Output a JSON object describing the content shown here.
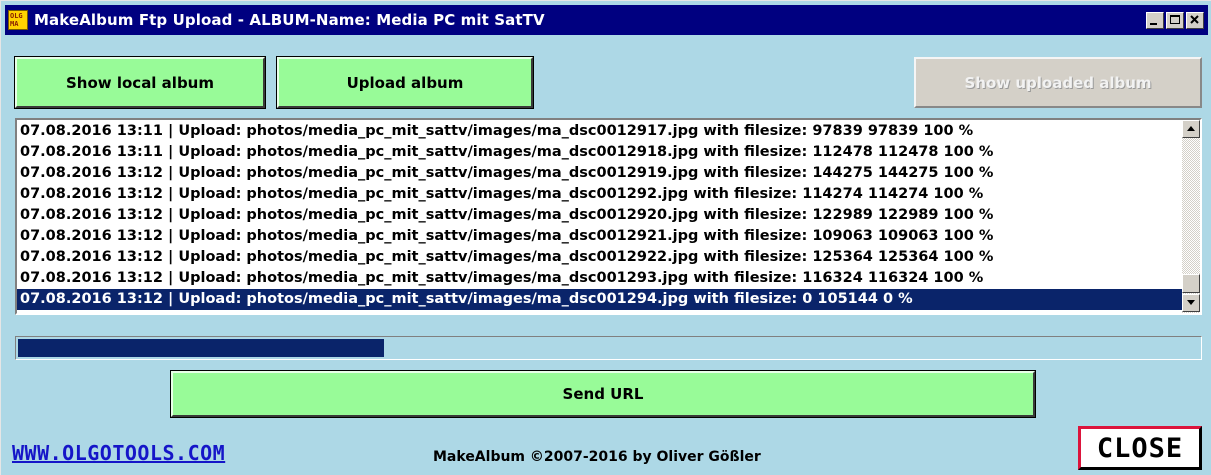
{
  "window": {
    "title": "MakeAlbum Ftp Upload - ALBUM-Name: Media PC mit SatTV",
    "icon": {
      "name": "olgo-app-icon",
      "line1": "OLG",
      "line2": "MA"
    },
    "controls": [
      "minimize-icon",
      "maximize-icon",
      "close-icon"
    ]
  },
  "toolbar": {
    "show_local": "Show local album",
    "upload": "Upload album",
    "show_uploaded": "Show uploaded album"
  },
  "log": {
    "rows": [
      "07.08.2016 13:11 | Upload: photos/media_pc_mit_sattv/images/ma_dsc0012917.jpg with filesize: 97839 97839 100 %",
      "07.08.2016 13:11 | Upload: photos/media_pc_mit_sattv/images/ma_dsc0012918.jpg with filesize: 112478 112478 100 %",
      "07.08.2016 13:12 | Upload: photos/media_pc_mit_sattv/images/ma_dsc0012919.jpg with filesize: 144275 144275 100 %",
      "07.08.2016 13:12 | Upload: photos/media_pc_mit_sattv/images/ma_dsc001292.jpg with filesize: 114274 114274 100 %",
      "07.08.2016 13:12 | Upload: photos/media_pc_mit_sattv/images/ma_dsc0012920.jpg with filesize: 122989 122989 100 %",
      "07.08.2016 13:12 | Upload: photos/media_pc_mit_sattv/images/ma_dsc0012921.jpg with filesize: 109063 109063 100 %",
      "07.08.2016 13:12 | Upload: photos/media_pc_mit_sattv/images/ma_dsc0012922.jpg with filesize: 125364 125364 100 %",
      "07.08.2016 13:12 | Upload: photos/media_pc_mit_sattv/images/ma_dsc001293.jpg with filesize: 116324 116324 100 %",
      "07.08.2016 13:12 | Upload: photos/media_pc_mit_sattv/images/ma_dsc001294.jpg with filesize: 0 105144 0 %"
    ],
    "selected_index": 8
  },
  "progress": {
    "fraction": 0.31
  },
  "send_url": "Send URL",
  "footer": {
    "site": "WWW.OLGOTOOLS.COM",
    "copyright": "MakeAlbum ©2007-2016 by Oliver Gößler",
    "close": "CLOSE"
  },
  "colors": {
    "background": "#ADD8E6",
    "titlebar": "#000080",
    "button_green": "#98FB98",
    "selection": "#0A246A",
    "link": "#1515C8",
    "close_accent": "#DC143C"
  }
}
